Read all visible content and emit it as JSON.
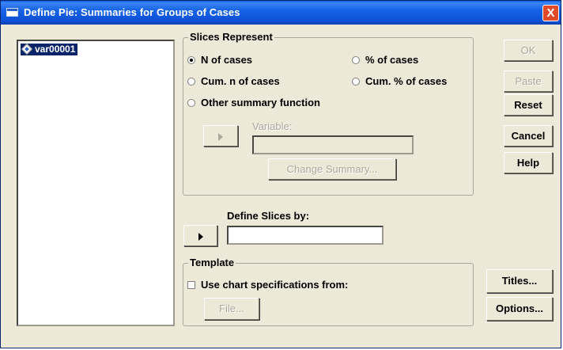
{
  "window": {
    "title": "Define Pie: Summaries for Groups of Cases",
    "close_label": "X"
  },
  "variables": {
    "items": [
      {
        "label": "var00001",
        "icon": "scale-variable-icon",
        "selected": true
      }
    ]
  },
  "slices_represent": {
    "legend": "Slices Represent",
    "options": [
      {
        "label": "N of cases",
        "selected": true
      },
      {
        "label": "% of cases",
        "selected": false
      },
      {
        "label": "Cum. n of cases",
        "selected": false
      },
      {
        "label": "Cum. % of cases",
        "selected": false
      },
      {
        "label": "Other summary function",
        "selected": false
      }
    ],
    "variable_label": "Variable:",
    "variable_value": "",
    "change_summary_label": "Change Summary...",
    "transfer_enabled": false
  },
  "define_slices": {
    "label": "Define Slices by:",
    "value": "",
    "transfer_enabled": true
  },
  "template": {
    "legend": "Template",
    "checkbox_label": "Use chart specifications from:",
    "checked": false,
    "file_label": "File..."
  },
  "buttons": {
    "ok": "OK",
    "paste": "Paste",
    "reset": "Reset",
    "cancel": "Cancel",
    "help": "Help",
    "titles": "Titles...",
    "options": "Options..."
  }
}
